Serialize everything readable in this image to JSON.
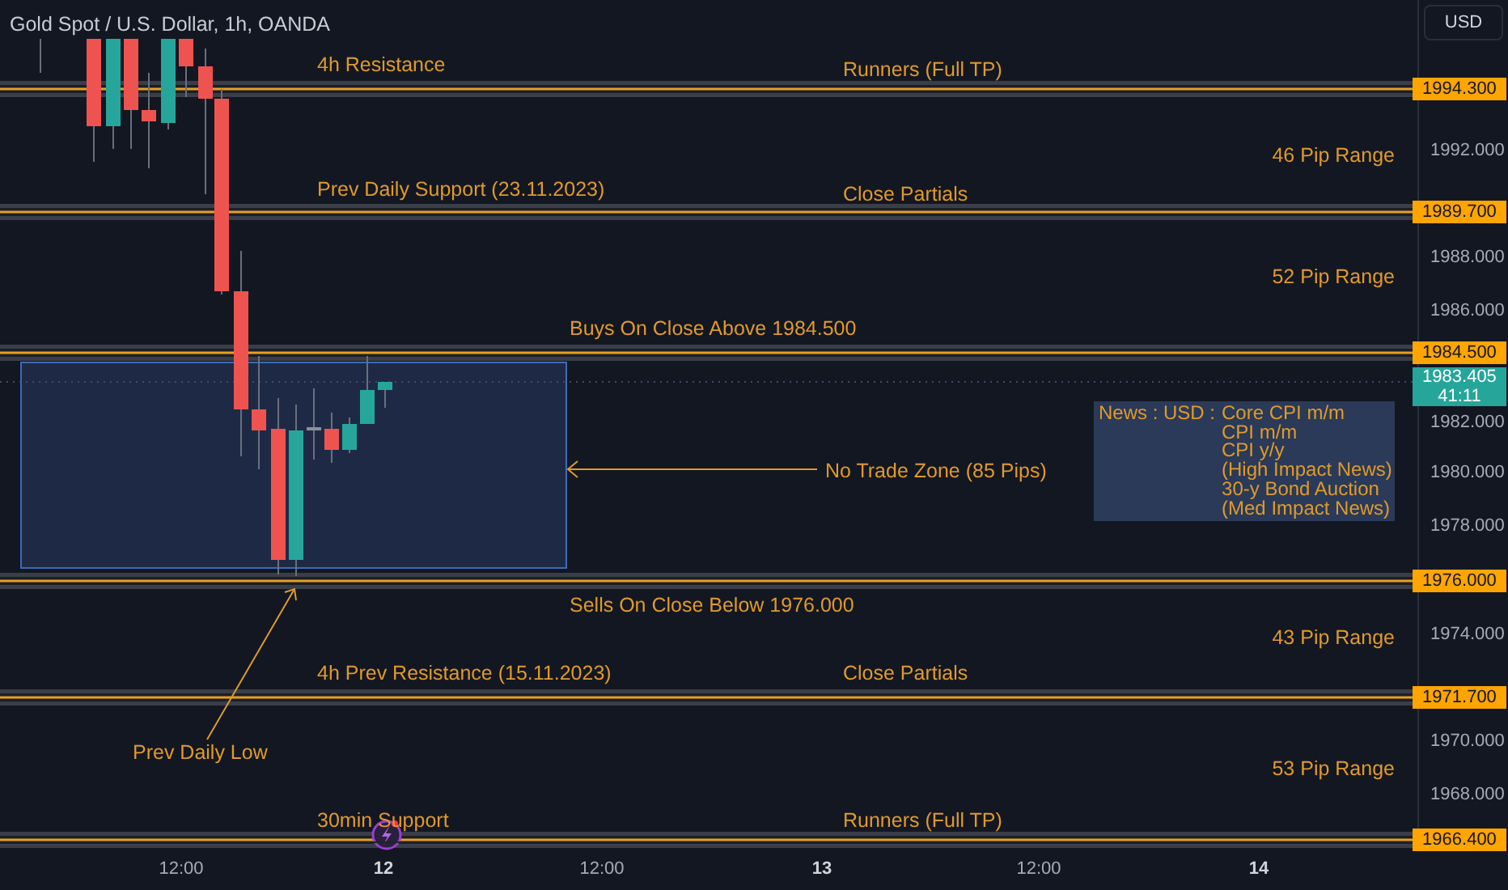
{
  "chart_title": "Gold Spot / U.S. Dollar, 1h, OANDA",
  "currency_button": "USD",
  "annotations": [
    {
      "text": "4h Resistance"
    },
    {
      "text": "Runners (Full TP)"
    },
    {
      "text": "46 Pip Range"
    },
    {
      "text": "Prev Daily Support (23.11.2023)"
    },
    {
      "text": "Close Partials"
    },
    {
      "text": "52 Pip Range"
    },
    {
      "text": "Buys On Close Above 1984.500"
    },
    {
      "text": "No Trade Zone (85 Pips)"
    },
    {
      "text": "Sells On Close Below 1976.000"
    },
    {
      "text": "43 Pip Range"
    },
    {
      "text": "4h Prev Resistance (15.11.2023)"
    },
    {
      "text": "Close Partials"
    },
    {
      "text": "Prev Daily Low"
    },
    {
      "text": "53 Pip Range"
    },
    {
      "text": "30min Support"
    },
    {
      "text": "Runners (Full TP)"
    }
  ],
  "news": {
    "label": "News : USD :",
    "items": [
      "Core CPI m/m",
      "CPI m/m",
      "CPI y/y",
      "(High Impact News)",
      "30-y Bond Auction",
      "(Med Impact News)"
    ]
  },
  "level_tags": [
    "1994.300",
    "1989.700",
    "1984.500",
    "1976.000",
    "1971.700",
    "1966.400"
  ],
  "price_axis": [
    "1992.000",
    "1988.000",
    "1986.000",
    "1982.000",
    "1980.000",
    "1978.000",
    "1974.000",
    "1970.000",
    "1968.000"
  ],
  "current_price": {
    "price": "1983.405",
    "countdown": "41:11"
  },
  "time_axis": [
    {
      "label": "12:00",
      "major": false
    },
    {
      "label": "12",
      "major": true
    },
    {
      "label": "12:00",
      "major": false
    },
    {
      "label": "13",
      "major": true
    },
    {
      "label": "12:00",
      "major": false
    },
    {
      "label": "14",
      "major": true
    }
  ]
}
